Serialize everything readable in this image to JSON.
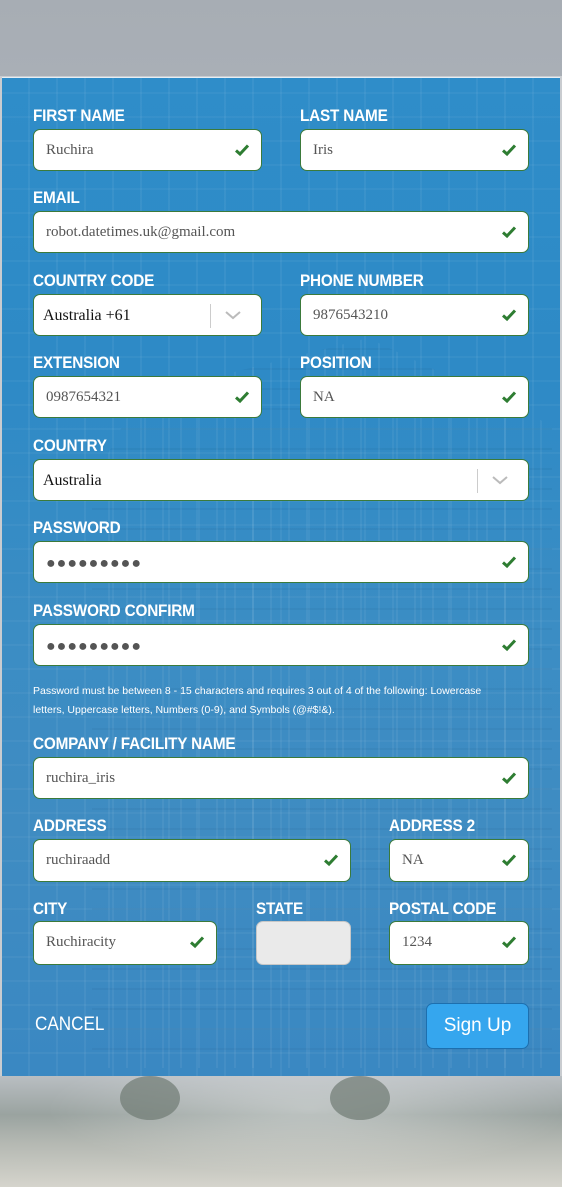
{
  "form": {
    "first_name": {
      "label": "FIRST NAME",
      "value": "Ruchira"
    },
    "last_name": {
      "label": "LAST NAME",
      "value": "Iris"
    },
    "email": {
      "label": "EMAIL",
      "value": "robot.datetimes.uk@gmail.com"
    },
    "country_code": {
      "label": "COUNTRY CODE",
      "value": "Australia +61"
    },
    "phone_number": {
      "label": "PHONE NUMBER",
      "value": "9876543210"
    },
    "extension": {
      "label": "EXTENSION",
      "value": "0987654321"
    },
    "position": {
      "label": "POSITION",
      "value": "NA"
    },
    "country": {
      "label": "COUNTRY",
      "value": "Australia"
    },
    "password": {
      "label": "PASSWORD",
      "value": "●●●●●●●●●"
    },
    "password_confirm": {
      "label": "PASSWORD CONFIRM",
      "value": "●●●●●●●●●"
    },
    "password_help": "Password must be between 8 - 15 characters and requires 3 out of 4 of the following: Lowercase letters, Uppercase letters, Numbers (0-9), and Symbols (@#$!&).",
    "company": {
      "label": "COMPANY / FACILITY NAME",
      "value": "ruchira_iris"
    },
    "address": {
      "label": "ADDRESS",
      "value": "ruchiraadd"
    },
    "address2": {
      "label": "ADDRESS 2",
      "value": "NA"
    },
    "city": {
      "label": "CITY",
      "value": "Ruchiracity"
    },
    "state": {
      "label": "STATE",
      "value": ""
    },
    "postal_code": {
      "label": "POSTAL CODE",
      "value": "1234"
    }
  },
  "actions": {
    "cancel": "CANCEL",
    "signup": "Sign Up"
  },
  "colors": {
    "panel": "#2f8dc9",
    "valid_check": "#2e7d32",
    "button": "#35a6ee"
  },
  "icons": {
    "valid": "check-icon",
    "dropdown": "chevron-down-icon"
  }
}
